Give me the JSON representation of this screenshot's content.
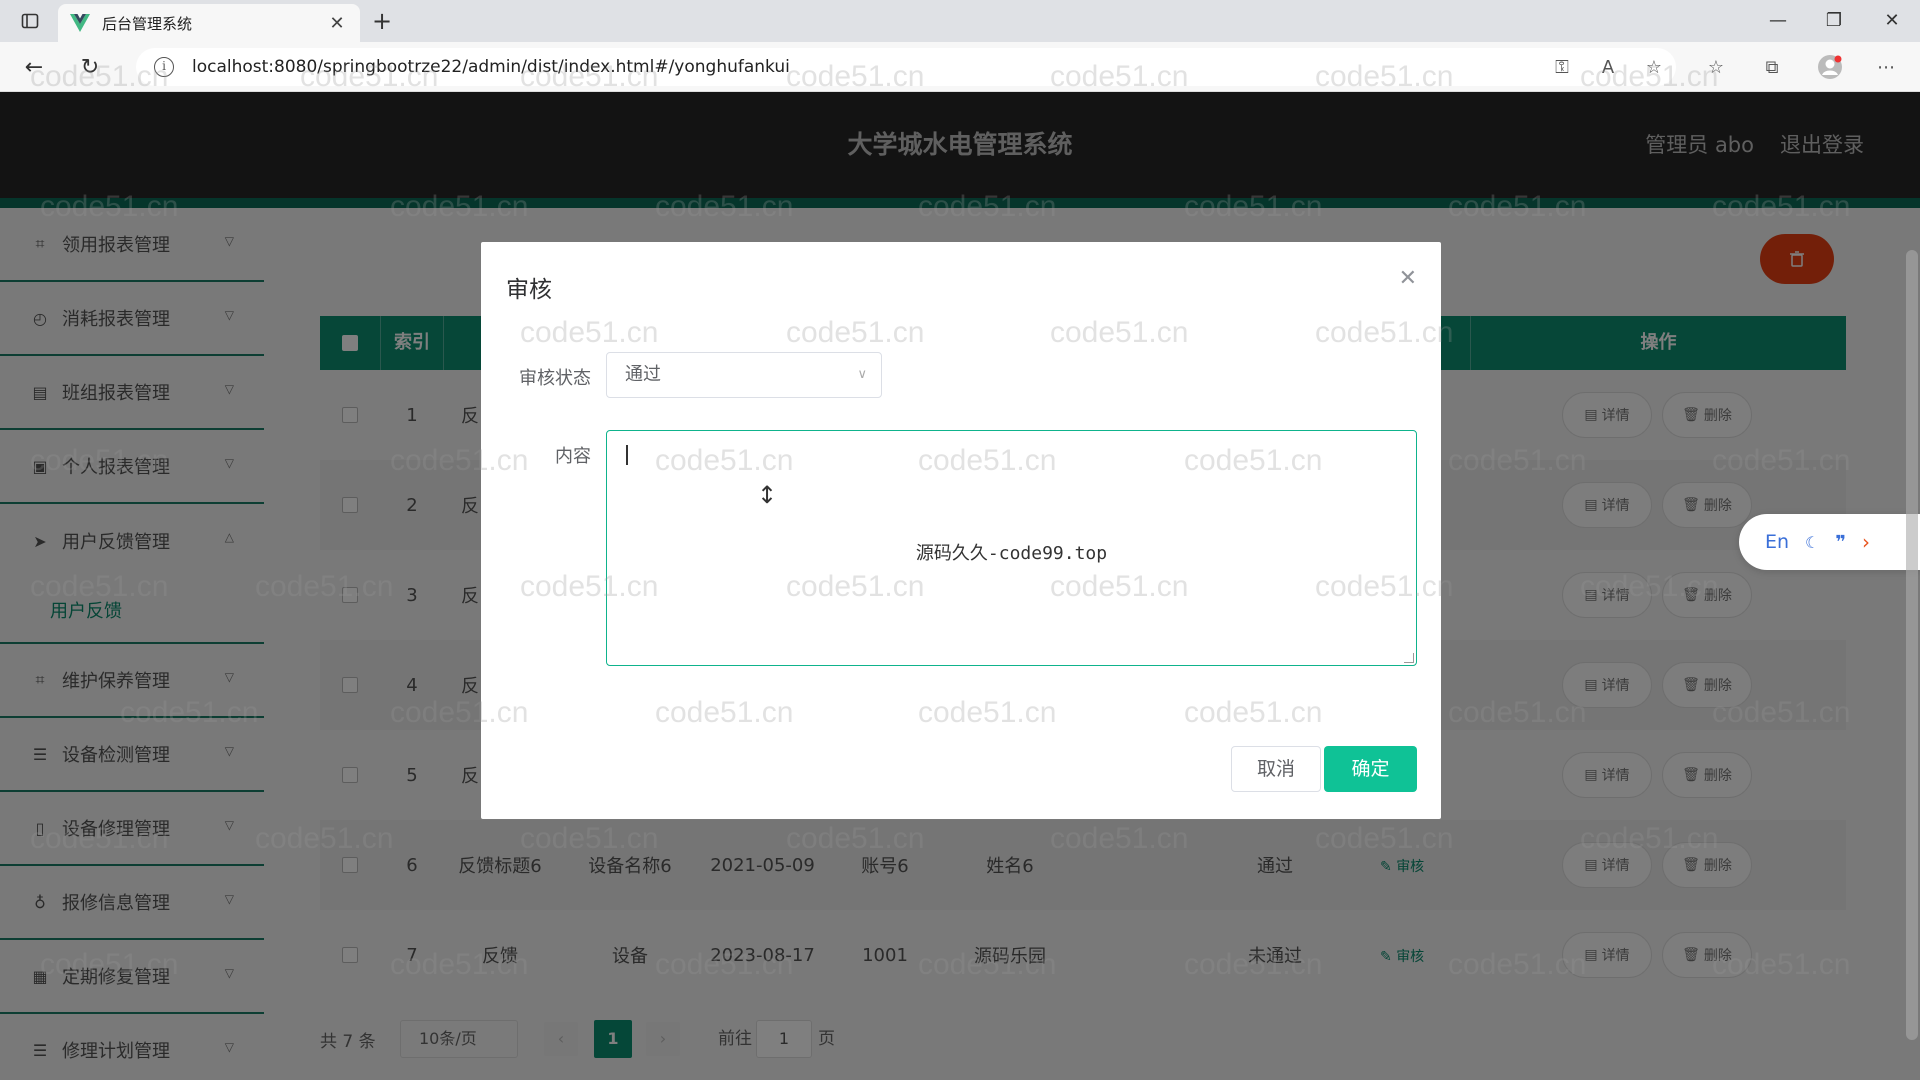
{
  "browser": {
    "tab_title": "后台管理系统",
    "url": "localhost:8080/springbootrze22/admin/dist/index.html#/yonghufankui"
  },
  "header": {
    "title": "大学城水电管理系统",
    "user": "管理员 abo",
    "logout": "退出登录"
  },
  "sidebar": {
    "items": [
      {
        "label": "领用报表管理",
        "icon": "crop-icon"
      },
      {
        "label": "消耗报表管理",
        "icon": "clock-icon"
      },
      {
        "label": "班组报表管理",
        "icon": "chart-icon"
      },
      {
        "label": "个人报表管理",
        "icon": "clipboard-icon"
      },
      {
        "label": "用户反馈管理",
        "icon": "send-icon",
        "expanded": true,
        "sub": "用户反馈"
      },
      {
        "label": "维护保养管理",
        "icon": "crop-icon"
      },
      {
        "label": "设备检测管理",
        "icon": "list-icon"
      },
      {
        "label": "设备修理管理",
        "icon": "phone-icon"
      },
      {
        "label": "报修信息管理",
        "icon": "mic-icon"
      },
      {
        "label": "定期修复管理",
        "icon": "grid-icon"
      },
      {
        "label": "修理计划管理",
        "icon": "list-icon"
      }
    ]
  },
  "table": {
    "headers": {
      "index": "索引",
      "ops": "操作"
    },
    "rows": [
      {
        "idx": "1",
        "title": "反"
      },
      {
        "idx": "2",
        "title": "反"
      },
      {
        "idx": "3",
        "title": "反"
      },
      {
        "idx": "4",
        "title": "反"
      },
      {
        "idx": "5",
        "title": "反"
      },
      {
        "idx": "6",
        "title": "反馈标题6",
        "device": "设备名称6",
        "date": "2021-05-09",
        "account": "账号6",
        "name": "姓名6",
        "status": "通过",
        "audit": "审核"
      },
      {
        "idx": "7",
        "title": "反馈",
        "device": "设备",
        "date": "2023-08-17",
        "account": "1001",
        "name": "源码乐园",
        "status": "未通过",
        "audit": "审核"
      }
    ],
    "detail_btn": "详情",
    "delete_btn": "删除"
  },
  "pager": {
    "total": "共 7 条",
    "page_size": "10条/页",
    "current": "1",
    "goto_prefix": "前往",
    "goto_value": "1",
    "goto_suffix": "页"
  },
  "dialog": {
    "title": "审核",
    "status_label": "审核状态",
    "status_value": "通过",
    "content_label": "内容",
    "content_note": "源码久久-code99.top",
    "cancel": "取消",
    "confirm": "确定"
  },
  "lang_widget": {
    "label": "En"
  },
  "watermark": "code51.cn",
  "colors": {
    "primary": "#0c8f71",
    "confirm": "#0fc296",
    "danger": "#e63e12",
    "header": "#262626"
  }
}
